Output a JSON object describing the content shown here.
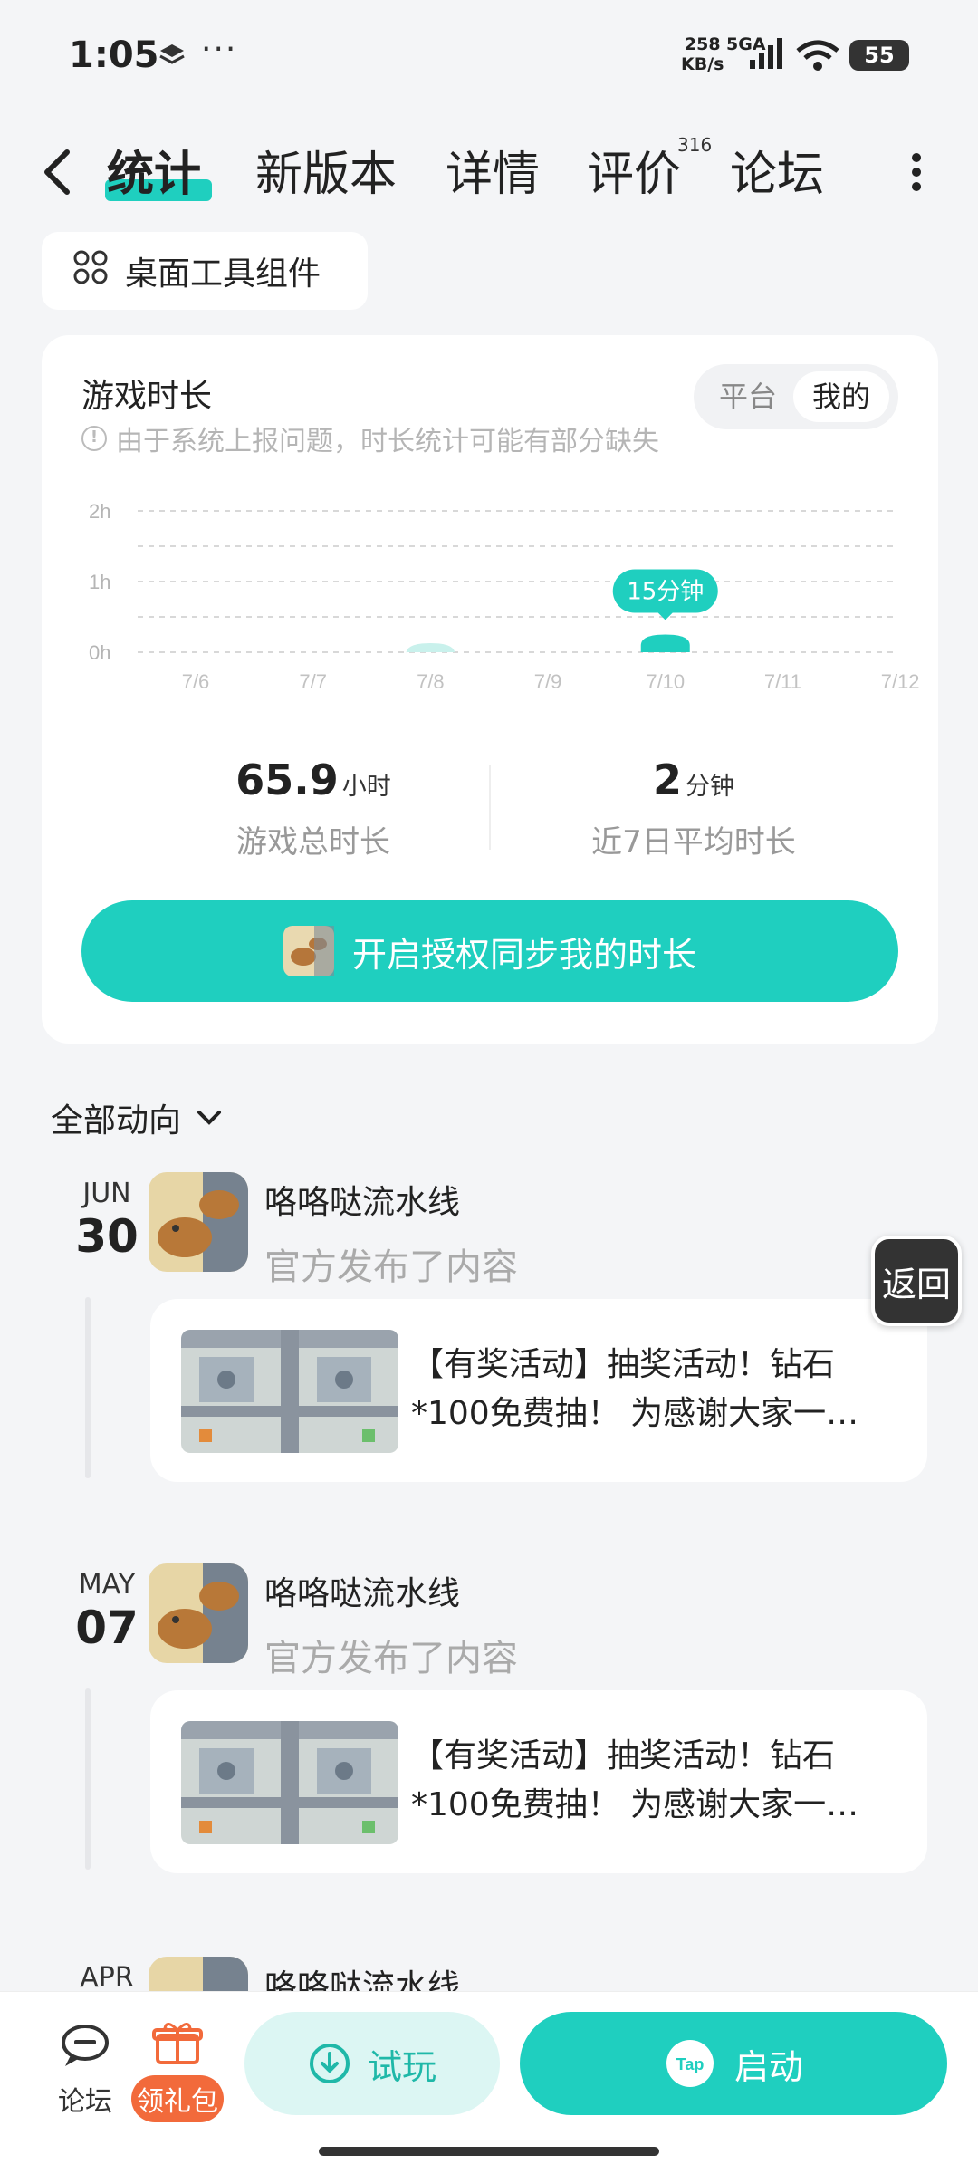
{
  "status_bar": {
    "time": "1:05",
    "more": "···",
    "net_speed": "258",
    "net_unit": "KB/s",
    "signal": "5GA",
    "battery": "55"
  },
  "nav": {
    "tabs": [
      "统计",
      "新版本",
      "详情",
      "评价",
      "论坛"
    ],
    "active_tab": "统计",
    "review_count": "316"
  },
  "widget_chip": {
    "label": "桌面工具组件"
  },
  "stats": {
    "title": "游戏时长",
    "note": "由于系统上报问题，时长统计可能有部分缺失",
    "toggle": {
      "option_platform": "平台",
      "option_mine": "我的",
      "selected": "我的"
    },
    "total_value": "65.9",
    "total_unit": "小时",
    "total_label": "游戏总时长",
    "avg_value": "2",
    "avg_unit": "分钟",
    "avg_label": "近7日平均时长",
    "sync_button": "开启授权同步我的时长"
  },
  "chart_data": {
    "type": "bar",
    "categories": [
      "7/6",
      "7/7",
      "7/8",
      "7/9",
      "7/10",
      "7/11",
      "7/12"
    ],
    "values_minutes": [
      0,
      0,
      2,
      0,
      15,
      0,
      0
    ],
    "highlight_label": "15分钟",
    "highlight_index": 4,
    "y_ticks": [
      "0h",
      "1h",
      "2h"
    ],
    "ylim_hours": [
      0,
      2
    ],
    "colors": {
      "bar": "#1fcfbf",
      "bar_faint": "#c9f1ec",
      "grid": "#d8d8d8"
    }
  },
  "feed": {
    "header": "全部动向",
    "entries": [
      {
        "month": "JUN",
        "day": "30",
        "game": "咯咯哒流水线",
        "action": "官方发布了内容",
        "post_line1": "【有奖活动】抽奖活动！钻石",
        "post_line2": "*100免费抽！ 为感谢大家一…"
      },
      {
        "month": "MAY",
        "day": "07",
        "game": "咯咯哒流水线",
        "action": "官方发布了内容",
        "post_line1": "【有奖活动】抽奖活动！钻石",
        "post_line2": "*100免费抽！ 为感谢大家一…"
      },
      {
        "month": "APR",
        "day": "",
        "game": "咯咯哒流水线"
      }
    ]
  },
  "float_back": "返回",
  "bottom_bar": {
    "forum": "论坛",
    "gift": "领礼包",
    "trial": "试玩",
    "launch": "启动",
    "tap_logo": "Tap"
  },
  "colors": {
    "accent": "#1fcfbf",
    "gift": "#f26a3b"
  }
}
